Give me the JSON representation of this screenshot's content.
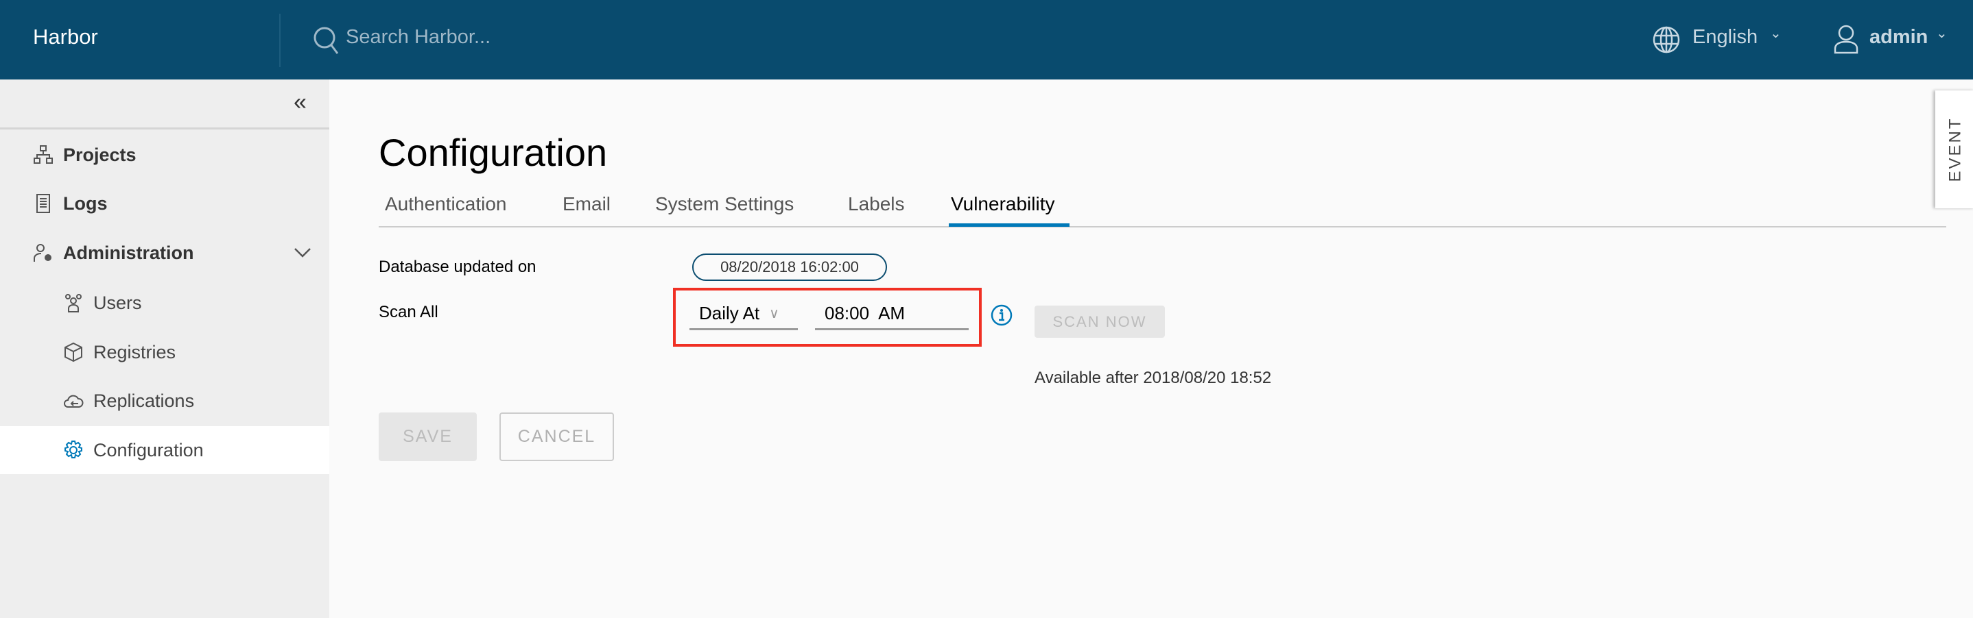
{
  "header": {
    "brand": "Harbor",
    "search_placeholder": "Search Harbor...",
    "language": "English",
    "user": "admin"
  },
  "sidebar": {
    "items": [
      {
        "label": "Projects",
        "icon": "sitemap-icon"
      },
      {
        "label": "Logs",
        "icon": "document-list-icon"
      },
      {
        "label": "Administration",
        "icon": "user-gear-icon"
      },
      {
        "label": "Users",
        "icon": "users-icon"
      },
      {
        "label": "Registries",
        "icon": "cube-icon"
      },
      {
        "label": "Replications",
        "icon": "cloud-sync-icon"
      },
      {
        "label": "Configuration",
        "icon": "gear-icon",
        "active": true
      }
    ]
  },
  "main": {
    "title": "Configuration",
    "tabs": [
      {
        "label": "Authentication"
      },
      {
        "label": "Email"
      },
      {
        "label": "System Settings"
      },
      {
        "label": "Labels"
      },
      {
        "label": "Vulnerability",
        "active": true
      }
    ],
    "db_label": "Database updated on",
    "db_value": "08/20/2018 16:02:00",
    "scan_label": "Scan All",
    "schedule": "Daily At",
    "time": "08:00  AM",
    "scan_now": "SCAN NOW",
    "available": "Available after 2018/08/20 18:52",
    "save": "SAVE",
    "cancel": "CANCEL"
  },
  "event_tab": "EVENT",
  "colors": {
    "header": "#094b6e",
    "accent": "#0079b8",
    "highlight": "#f03024"
  }
}
